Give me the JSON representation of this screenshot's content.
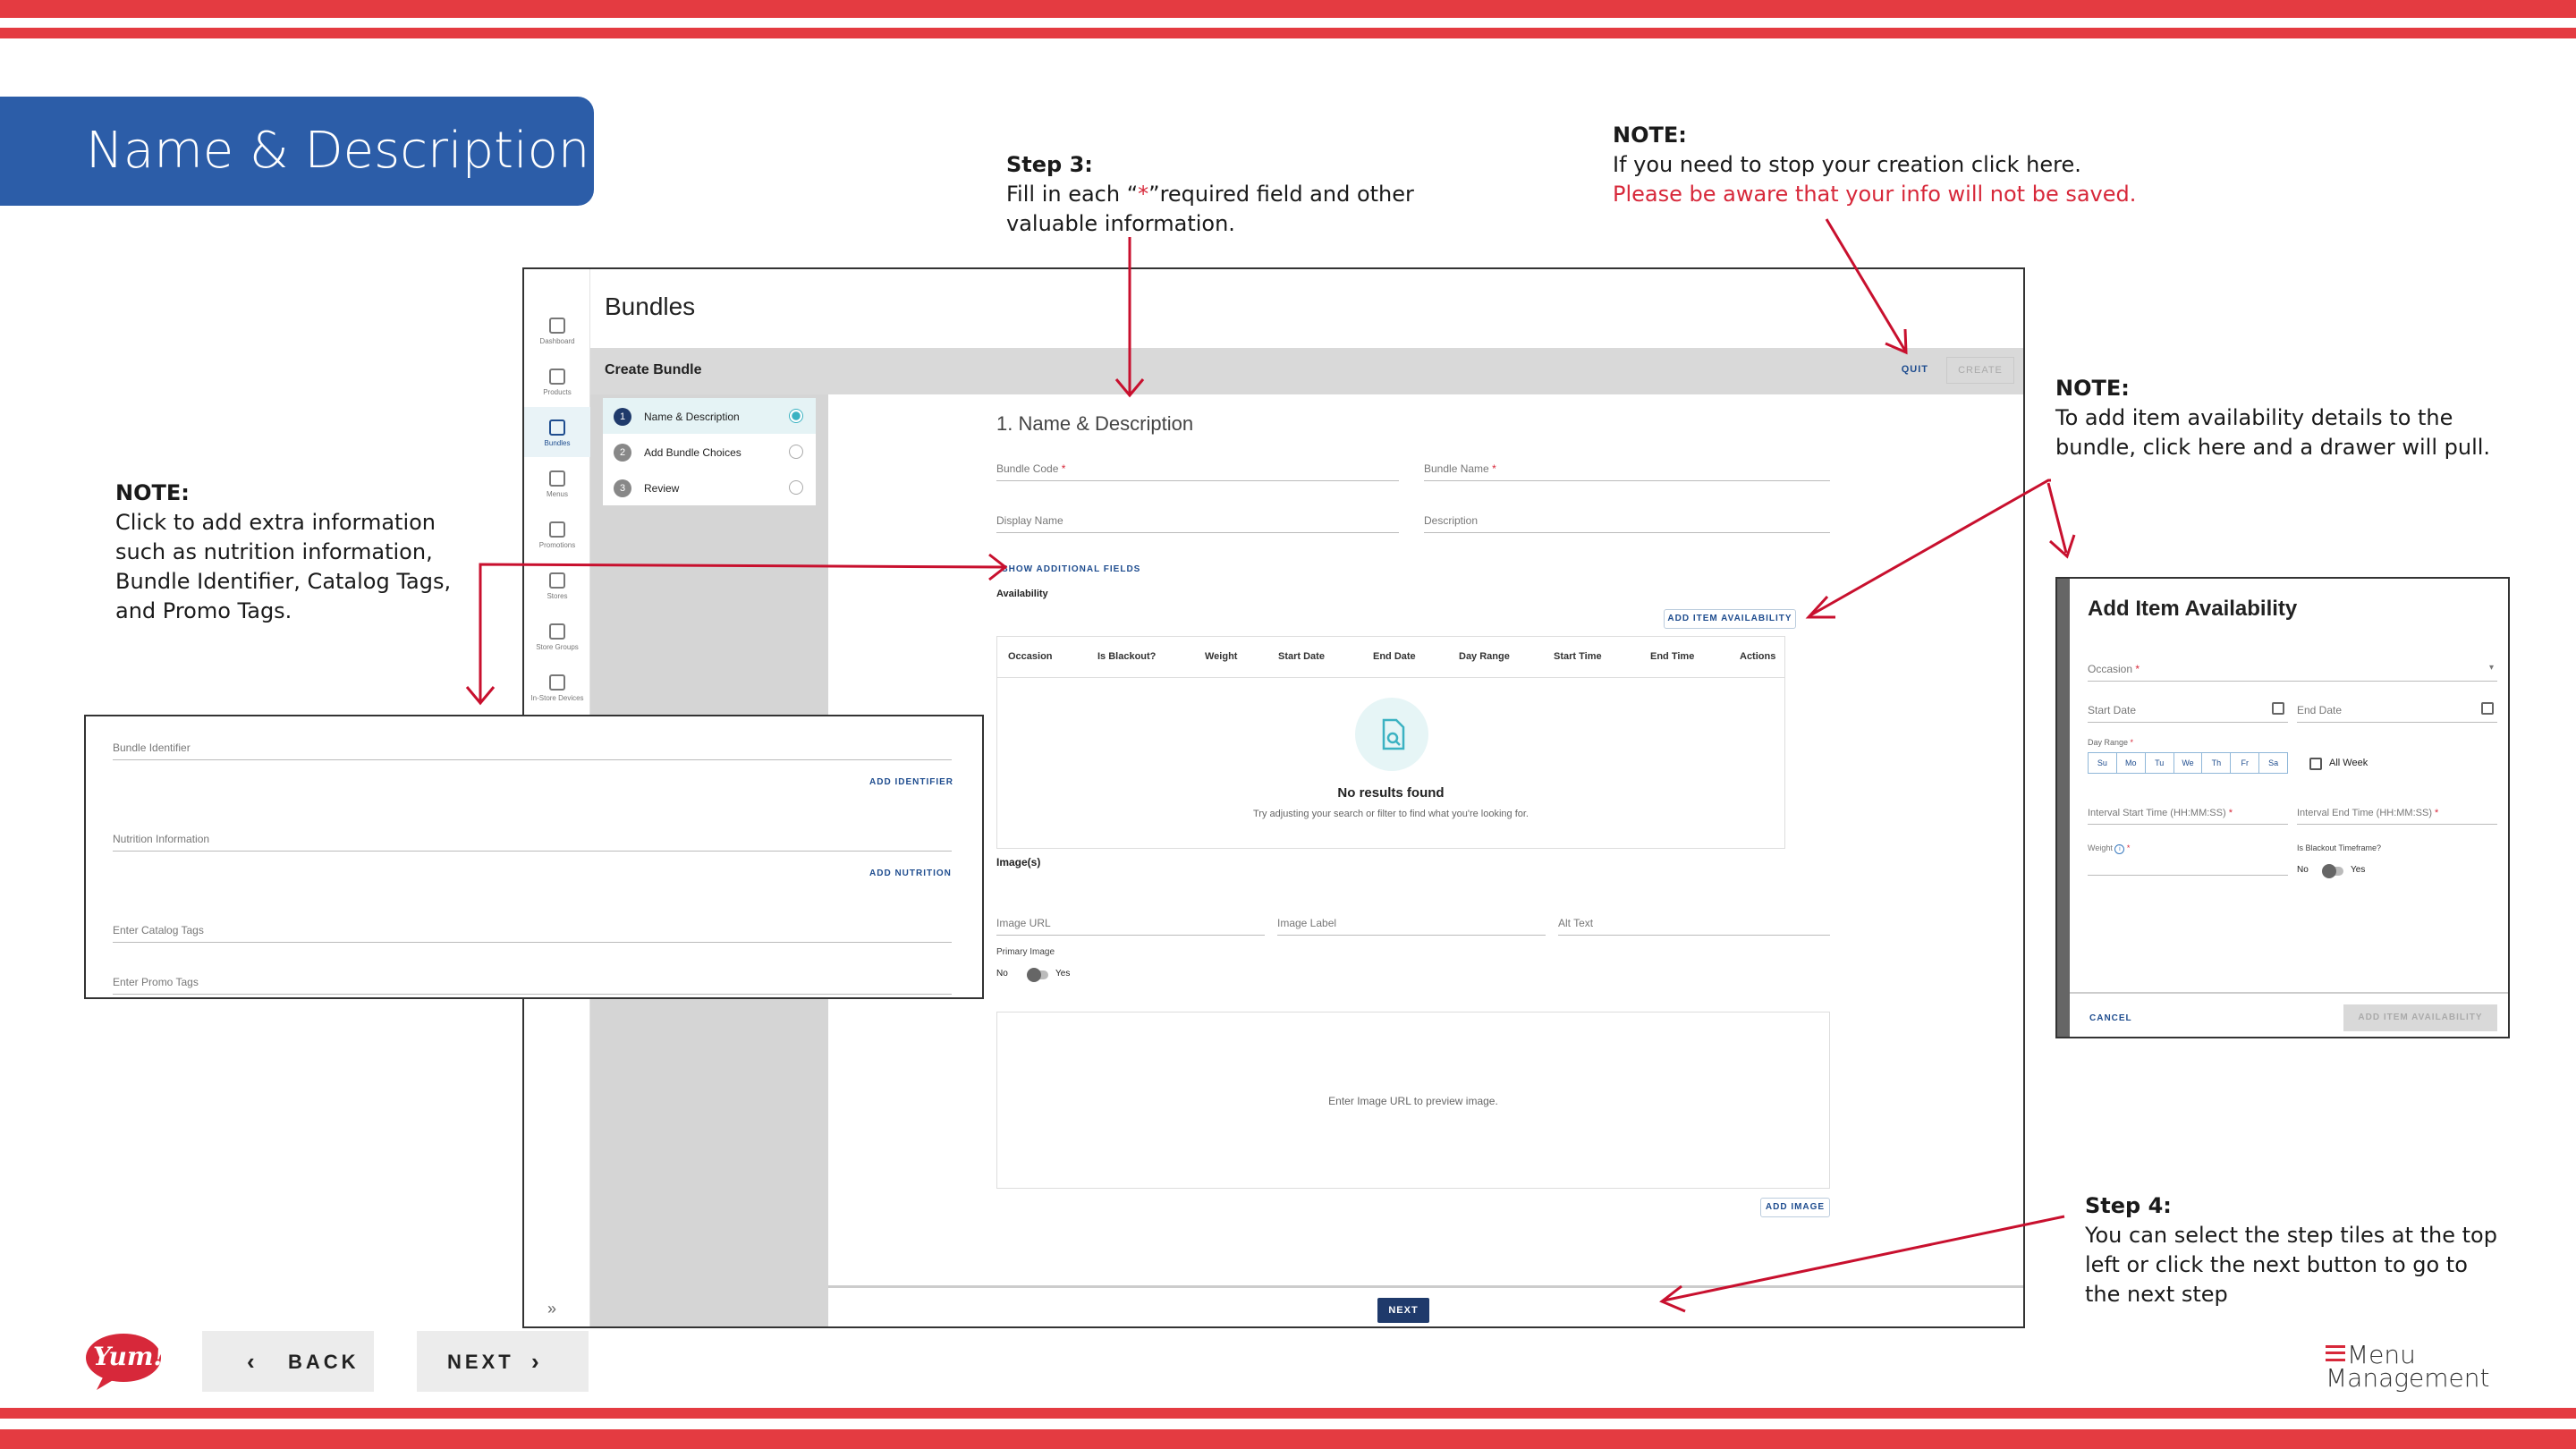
{
  "slide": {
    "title": "Name & Description",
    "colors": {
      "stripe": "#e43b41",
      "title_bg": "#2c5da8",
      "annotation": "#c8102e",
      "primary": "#1f3a6b"
    }
  },
  "notes": {
    "step3": {
      "heading": "Step 3:",
      "line1a": "Fill in each “",
      "star": "*",
      "line1b": "”required field and other",
      "line2": "valuable information."
    },
    "quit": {
      "heading": "NOTE:",
      "line1": "If you need to stop your creation click here.",
      "line2": "Please be aware that your info will not be saved."
    },
    "availability": {
      "heading": "NOTE:",
      "line1": "To add item availability details to the",
      "line2": "bundle, click here and a drawer will pull."
    },
    "additional": {
      "heading": "NOTE:",
      "line1": "Click to add extra information",
      "line2": "such as nutrition information,",
      "line3": "Bundle Identifier, Catalog Tags,",
      "line4": "and Promo Tags."
    },
    "step4": {
      "heading": "Step 4:",
      "line1": "You can select the step tiles at the top",
      "line2": "left or click the next button to go to",
      "line3": "the next step"
    }
  },
  "rail": {
    "items": [
      {
        "label": "Dashboard",
        "icon": "home-icon"
      },
      {
        "label": "Products",
        "icon": "box-icon"
      },
      {
        "label": "Bundles",
        "icon": "cube-icon",
        "active": true
      },
      {
        "label": "Menus",
        "icon": "document-icon"
      },
      {
        "label": "Promotions",
        "icon": "tag-icon"
      },
      {
        "label": "Stores",
        "icon": "store-icon"
      },
      {
        "label": "Store Groups",
        "icon": "grid-icon"
      },
      {
        "label": "In-Store Devices",
        "icon": "monitor-icon"
      }
    ],
    "expand": "»"
  },
  "app": {
    "title": "Bundles",
    "bar_label": "Create Bundle",
    "quit": "QUIT",
    "create": "CREATE",
    "steps": [
      {
        "num": "1",
        "label": "Name & Description",
        "active": true
      },
      {
        "num": "2",
        "label": "Add Bundle Choices"
      },
      {
        "num": "3",
        "label": "Review"
      }
    ],
    "section_title": "1. Name & Description",
    "fields": {
      "bundle_code": "Bundle Code",
      "bundle_name": "Bundle Name",
      "display_name": "Display Name",
      "description": "Description",
      "req": "*"
    },
    "show_additional": "SHOW ADDITIONAL FIELDS",
    "availability_label": "Availability",
    "add_item_availability": "ADD ITEM AVAILABILITY",
    "table_headers": [
      "Occasion",
      "Is Blackout?",
      "Weight",
      "Start Date",
      "End Date",
      "Day Range",
      "Start Time",
      "End Time",
      "Actions"
    ],
    "empty_title": "No results found",
    "empty_sub": "Try adjusting your search or filter to find what you're looking for.",
    "images_label": "Image(s)",
    "image_url": "Image URL",
    "image_label": "Image Label",
    "alt_text": "Alt Text",
    "primary_image": "Primary Image",
    "no": "No",
    "yes": "Yes",
    "preview_text": "Enter Image URL to preview image.",
    "add_image": "ADD IMAGE",
    "next": "NEXT"
  },
  "inset": {
    "bundle_identifier": "Bundle Identifier",
    "add_identifier": "ADD IDENTIFIER",
    "nutrition_information": "Nutrition Information",
    "add_nutrition": "ADD NUTRITION",
    "catalog_tags": "Enter Catalog Tags",
    "promo_tags": "Enter Promo Tags"
  },
  "drawer": {
    "title": "Add Item Availability",
    "occasion": "Occasion",
    "start_date": "Start Date",
    "end_date": "End Date",
    "day_range": "Day Range",
    "days": [
      "Su",
      "Mo",
      "Tu",
      "We",
      "Th",
      "Fr",
      "Sa"
    ],
    "all_week": "All Week",
    "interval_start": "Interval Start Time (HH:MM:SS)",
    "interval_end": "Interval End Time (HH:MM:SS)",
    "weight": "Weight",
    "blackout": "Is Blackout Timeframe?",
    "no": "No",
    "yes": "Yes",
    "cancel": "CANCEL",
    "add": "ADD ITEM AVAILABILITY"
  },
  "nav": {
    "back": "BACK",
    "next": "NEXT"
  },
  "brand": {
    "logo": "Yum!",
    "product_line1": "Menu",
    "product_line2": "Management"
  }
}
